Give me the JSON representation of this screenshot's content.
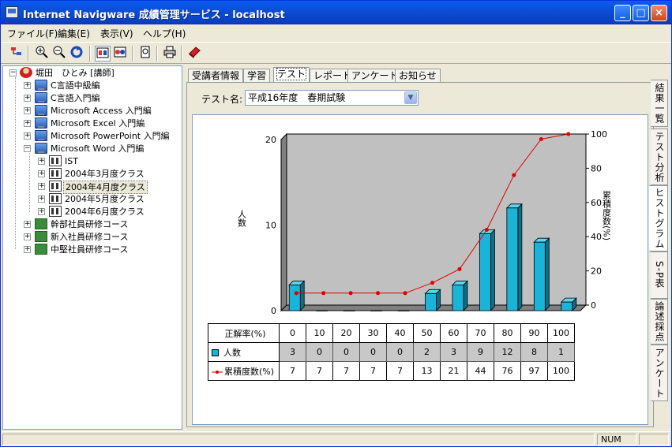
{
  "window": {
    "title": "Internet Navigware 成績管理サービス - localhost"
  },
  "menu": [
    "ファイル(F)",
    "編集(E)",
    "表示(V)",
    "ヘルプ(H)"
  ],
  "toolbar": {
    "icons": [
      "tree-icon",
      "zoom-in-icon",
      "zoom-out-icon",
      "refresh-icon",
      "split-view-icon",
      "compare-icon",
      "preview-icon",
      "print-icon",
      "book-icon"
    ]
  },
  "tree": {
    "root": "堀田　ひとみ [講師]",
    "items": [
      {
        "label": "C言語中級編"
      },
      {
        "label": "C言語入門編"
      },
      {
        "label": "Microsoft Access 入門編"
      },
      {
        "label": "Microsoft Excel 入門編"
      },
      {
        "label": "Microsoft PowerPoint 入門編"
      },
      {
        "label": "Microsoft Word 入門編"
      },
      {
        "label": "IST"
      },
      {
        "label": "2004年3月度クラス"
      },
      {
        "label": "2004年4月度クラス"
      },
      {
        "label": "2004年5月度クラス"
      },
      {
        "label": "2004年6月度クラス"
      },
      {
        "label": "幹部社員研修コース"
      },
      {
        "label": "新入社員研修コース"
      },
      {
        "label": "中堅社員研修コース"
      }
    ]
  },
  "tabs": [
    "受講者情報",
    "学習",
    "テスト",
    "レポート",
    "アンケート",
    "お知らせ"
  ],
  "active_tab": "テスト",
  "test_select": {
    "label": "テスト名:",
    "value": "平成16年度　春期試験"
  },
  "side_tabs": [
    "結果一覧",
    "テスト分析",
    "ヒストグラム",
    "S-P表",
    "論述採点",
    "アンケート"
  ],
  "chart_data": {
    "type": "bar",
    "categories": [
      "0",
      "10",
      "20",
      "30",
      "40",
      "50",
      "60",
      "70",
      "80",
      "90",
      "100"
    ],
    "xlabel": "正解率(%)",
    "ylabel": "人数",
    "y2label": "累積度数(%)",
    "ylim": [
      0,
      20
    ],
    "y2lim": [
      0,
      100
    ],
    "yticks": [
      0,
      10,
      20
    ],
    "y2ticks": [
      0,
      20,
      40,
      60,
      80,
      100
    ],
    "series": [
      {
        "name": "人数",
        "type": "bar",
        "values": [
          3,
          0,
          0,
          0,
          0,
          2,
          3,
          9,
          12,
          8,
          1
        ],
        "color": "#1ab4d8"
      },
      {
        "name": "累積度数(%)",
        "type": "line",
        "axis": "right",
        "values": [
          7,
          7,
          7,
          7,
          7,
          13,
          21,
          44,
          76,
          97,
          100
        ],
        "color": "#e00000"
      }
    ],
    "table": {
      "header": "正解率(%)"
    }
  },
  "status": {
    "num": "NUM"
  }
}
